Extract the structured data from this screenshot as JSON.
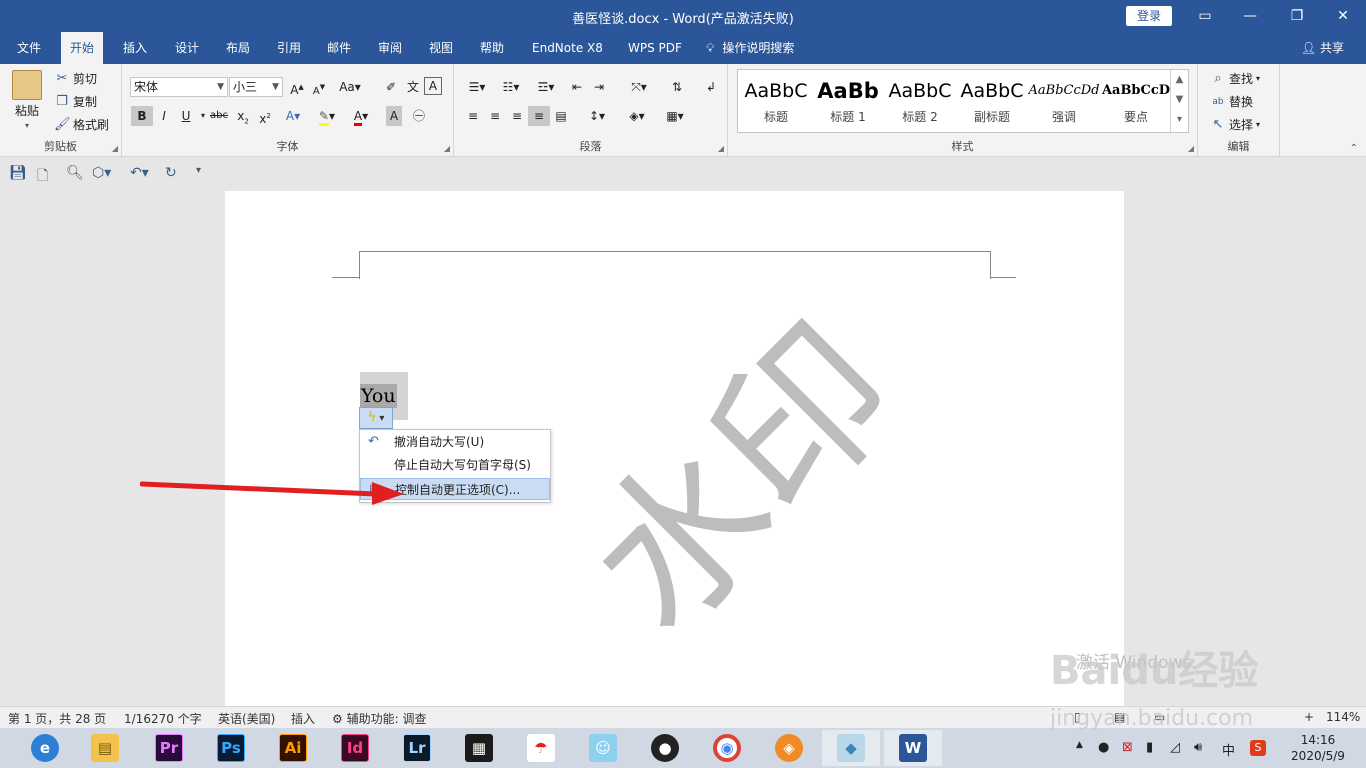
{
  "titlebar": {
    "title": "善医怪谈.docx  -  Word(产品激活失败)",
    "login": "登录",
    "minimize": "□",
    "restore": "❐",
    "close": "✕"
  },
  "tabs": [
    "文件",
    "开始",
    "插入",
    "设计",
    "布局",
    "引用",
    "邮件",
    "审阅",
    "视图",
    "帮助",
    "EndNote X8",
    "WPS PDF"
  ],
  "tab_search": "操作说明搜索",
  "share": "共享",
  "ribbon": {
    "clipboard": {
      "label": "剪贴板",
      "paste": "粘贴",
      "cut": "剪切",
      "copy": "复制",
      "format_painter": "格式刷"
    },
    "font": {
      "label": "字体",
      "font_name": "宋体",
      "font_size": "小三"
    },
    "paragraph": {
      "label": "段落"
    },
    "styles": {
      "label": "样式",
      "items": [
        {
          "preview": "AaBbC",
          "name": "标题"
        },
        {
          "preview": "AaBb",
          "name": "标题 1"
        },
        {
          "preview": "AaBbC",
          "name": "标题 2"
        },
        {
          "preview": "AaBbC",
          "name": "副标题"
        },
        {
          "preview": "AaBbCcDd",
          "name": "强调"
        },
        {
          "preview": "AaBbCcD",
          "name": "要点"
        }
      ]
    },
    "editing": {
      "label": "编辑",
      "find": "查找",
      "replace": "替换",
      "select": "选择"
    }
  },
  "document": {
    "word": "You",
    "watermark": "水印",
    "autocorrect_menu": [
      "撤消自动大写(U)",
      "停止自动大写句首字母(S)",
      "控制自动更正选项(C)..."
    ]
  },
  "overlay": {
    "activate": "激活 Windows",
    "baidu": "Baidu经验",
    "baidu_url": "jingyan.baidu.com"
  },
  "statusbar": {
    "page": "第 1 页，共 28 页",
    "words": "1/16270 个字",
    "language": "英语(美国)",
    "mode": "插入",
    "accessibility": "辅助功能: 调查",
    "zoom": "114%"
  },
  "taskbar": {
    "apps": [
      {
        "name": "browser",
        "label": "e",
        "bg": "#2d7fd6",
        "fg": "#ffffff"
      },
      {
        "name": "explorer",
        "label": "▤",
        "bg": "#f2c24a",
        "fg": "#7a5a00"
      },
      {
        "name": "premiere",
        "label": "Pr",
        "bg": "#2a0a3a",
        "fg": "#e27bff"
      },
      {
        "name": "photoshop",
        "label": "Ps",
        "bg": "#0a1c33",
        "fg": "#31a8ff"
      },
      {
        "name": "illustrator",
        "label": "Ai",
        "bg": "#331100",
        "fg": "#ff9a00"
      },
      {
        "name": "indesign",
        "label": "Id",
        "bg": "#3a0a22",
        "fg": "#ff3e8e"
      },
      {
        "name": "lightroom",
        "label": "Lr",
        "bg": "#0b1a28",
        "fg": "#a3d4ff"
      },
      {
        "name": "video",
        "label": "▦",
        "bg": "#1b1b1b",
        "fg": "#ffffff"
      },
      {
        "name": "umbrella",
        "label": "☂",
        "bg": "#ffffff",
        "fg": "#d22"
      },
      {
        "name": "wechat-app",
        "label": "☺",
        "bg": "#8fd0ef",
        "fg": "#ffffff"
      },
      {
        "name": "qq",
        "label": "●",
        "bg": "#222222",
        "fg": "#ffffff"
      },
      {
        "name": "chrome",
        "label": "◉",
        "bg": "#ffffff",
        "fg": "#4285f4"
      },
      {
        "name": "player",
        "label": "◈",
        "bg": "#f08a24",
        "fg": "#ffffff"
      },
      {
        "name": "notes",
        "label": "◆",
        "bg": "#b8d8ea",
        "fg": "#3a86b5"
      },
      {
        "name": "word",
        "label": "W",
        "bg": "#2b579a",
        "fg": "#ffffff"
      }
    ],
    "ime": "中",
    "time": "14:16",
    "date": "2020/5/9"
  }
}
